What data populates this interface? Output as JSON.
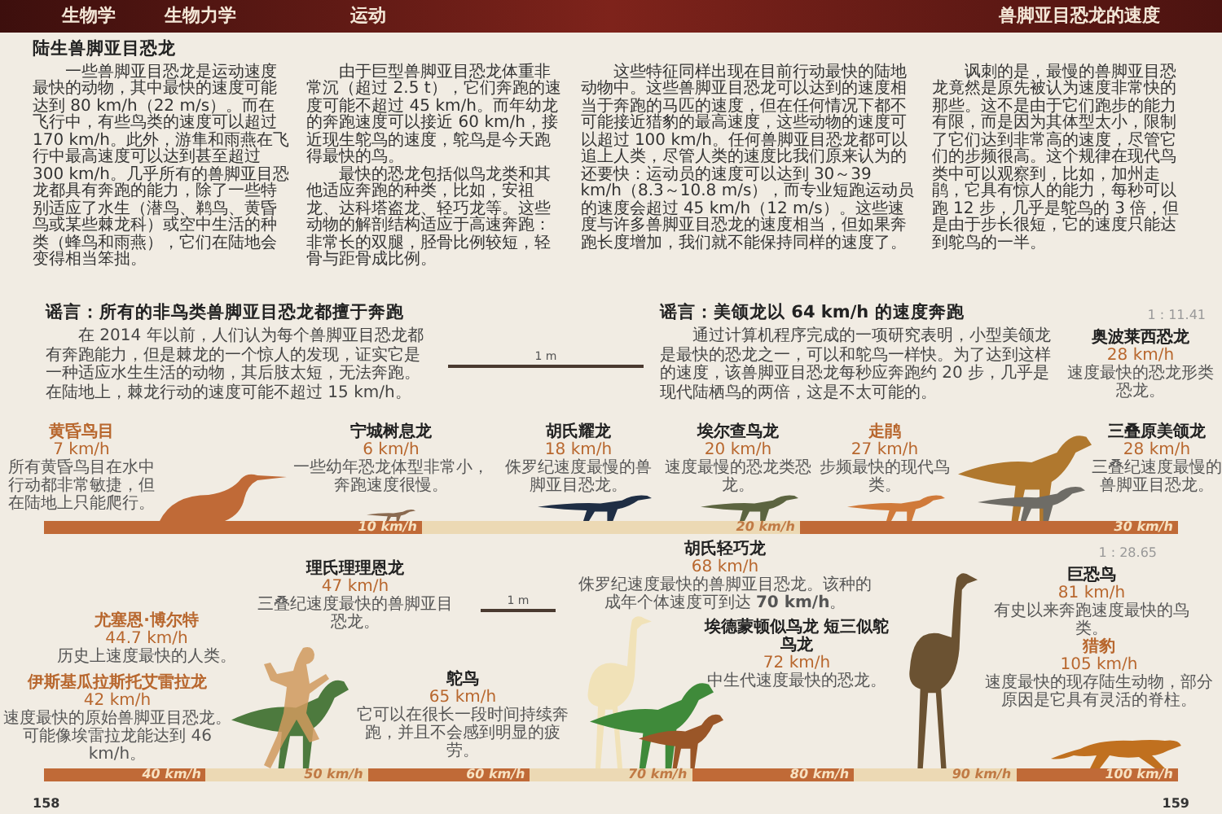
{
  "header": {
    "tabs": [
      {
        "label": "生物学"
      },
      {
        "label": "生物力学"
      },
      {
        "label": "运动"
      }
    ],
    "section_title": "兽脚亚目恐龙的速度"
  },
  "intro": {
    "heading": "陆生兽脚亚目恐龙",
    "columns": [
      [
        "一些兽脚亚目恐龙是运动速度最快的动物，其中最快的速度可能达到 80 km/h（22 m/s）。而在飞行中，有些鸟类的速度可以超过 170 km/h。此外，游隼和雨燕在飞行中最高速度可以达到甚至超过 300 km/h。几乎所有的兽脚亚目恐龙都具有奔跑的能力，除了一些特别适应了水生（潜鸟、鹈鸟、黄昏鸟或某些棘龙科）或空中生活的种类（蜂鸟和雨燕），它们在陆地会变得相当笨拙。"
      ],
      [
        "由于巨型兽脚亚目恐龙体重非常沉（超过 2.5 t），它们奔跑的速度可能不超过 45 km/h。而年幼龙的奔跑速度可以接近 60 km/h，接近现生鸵鸟的速度，鸵鸟是今天跑得最快的鸟。",
        "最快的恐龙包括似鸟龙类和其他适应奔跑的种类，比如，安祖龙、达科塔盗龙、轻巧龙等。这些动物的解剖结构适应于高速奔跑：非常长的双腿，胫骨比例较短，轻骨与距骨成比例。"
      ],
      [
        "这些特征同样出现在目前行动最快的陆地动物中。这些兽脚亚目恐龙可以达到的速度相当于奔跑的马匹的速度，但在任何情况下都不可能接近猎豹的最高速度，这些动物的速度可以超过 100 km/h。任何兽脚亚目恐龙都可以追上人类，尽管人类的速度比我们原来认为的还要快：运动员的速度可以达到 30～39 km/h（8.3～10.8 m/s），而专业短跑运动员的速度会超过 45 km/h（12 m/s）。这些速度与许多兽脚亚目恐龙的速度相当，但如果奔跑长度增加，我们就不能保持同样的速度了。"
      ],
      [
        "讽刺的是，最慢的兽脚亚目恐龙竟然是原先被认为速度非常快的那些。这不是由于它们跑步的能力有限，而是因为其体型太小，限制了它们达到非常高的速度，尽管它们的步频很高。这个规律在现代鸟类中可以观察到，比如，加州走鹃，它具有惊人的能力，每秒可以跑 12 步，几乎是鸵鸟的 3 倍，但是由于步长很短，它的速度只能达到鸵鸟的一半。"
      ]
    ]
  },
  "charts": [
    {
      "myths": [
        {
          "heading": "谣言：所有的非鸟类兽脚亚目恐龙都擅于奔跑",
          "text": "在 2014 年以前，人们认为每个兽脚亚目恐龙都有奔跑能力，但是棘龙的一个惊人的发现，证实它是一种适应水生生活的动物，其后肢太短，无法奔跑。在陆地上，棘龙行动的速度可能不超过 15 km/h。"
        },
        {
          "heading": "谣言：美颌龙以 64 km/h 的速度奔跑",
          "text": "通过计算机程序完成的一项研究表明，小型美颌龙是最快的恐龙之一，可以和鸵鸟一样快。为了达到这样的速度，该兽脚亚目恐龙每秒应奔跑约 20 步，几乎是现代陆栖鸟的两倍，这是不太可能的。"
        }
      ],
      "scale_bar": "1 m",
      "scale_ratio": "1 : 11.41",
      "animals": [
        {
          "kind": "dinosaur",
          "name": "奥波莱西恐龙",
          "speed": "28 km/h",
          "note": "速度最快的恐龙形类恐龙。"
        },
        {
          "kind": "comparison",
          "name": "黄昏鸟目",
          "speed": "7 km/h",
          "note": "所有黄昏鸟目在水中行动都非常敏捷，但在陆地上只能爬行。"
        },
        {
          "kind": "dinosaur",
          "name": "宁城树息龙",
          "speed": "6 km/h",
          "note": "一些幼年恐龙体型非常小，奔跑速度很慢。"
        },
        {
          "kind": "dinosaur",
          "name": "胡氏耀龙",
          "speed": "18 km/h",
          "note": "侏罗纪速度最慢的兽脚亚目恐龙。"
        },
        {
          "kind": "dinosaur",
          "name": "埃尔查鸟龙",
          "speed": "20 km/h",
          "note": "速度最慢的恐龙类恐龙。"
        },
        {
          "kind": "comparison",
          "name": "走鹃",
          "speed": "27 km/h",
          "note": "步频最快的现代鸟类。"
        },
        {
          "kind": "dinosaur",
          "name": "三叠原美颌龙",
          "speed": "28 km/h",
          "note": "三叠纪速度最慢的兽脚亚目恐龙。"
        }
      ],
      "speed_bar": [
        {
          "label": "10 km/h",
          "kind": "dark"
        },
        {
          "label": "20 km/h",
          "kind": "light"
        },
        {
          "label": "30 km/h",
          "kind": "dark"
        }
      ]
    },
    {
      "scale_bar": "1 m",
      "scale_ratio": "1 : 28.65",
      "animals": [
        {
          "kind": "comparison",
          "name": "尤塞恩·博尔特",
          "speed": "44.7 km/h",
          "note": "历史上速度最快的人类。"
        },
        {
          "kind": "comparison",
          "name": "伊斯基瓜拉斯托艾雷拉龙",
          "speed": "42 km/h",
          "note": "速度最快的原始兽脚亚目恐龙。可能像埃雷拉龙能达到 46 km/h。"
        },
        {
          "kind": "dinosaur",
          "name": "理氏理理恩龙",
          "speed": "47 km/h",
          "note": "三叠纪速度最快的兽脚亚目恐龙。"
        },
        {
          "kind": "dinosaur",
          "name": "鸵鸟",
          "speed": "65 km/h",
          "note": "它可以在很长一段时间持续奔跑，并且不会感到明显的疲劳。"
        },
        {
          "kind": "dinosaur",
          "name": "胡氏轻巧龙",
          "speed": "68 km/h",
          "note": "侏罗纪速度最快的兽脚亚目恐龙。该种的成年个体速度可到达 **70 km/h**。"
        },
        {
          "kind": "dinosaur",
          "name": "埃德蒙顿似鸟龙 短三似鸵鸟龙",
          "speed": "72 km/h",
          "note": "中生代速度最快的恐龙。"
        },
        {
          "kind": "dinosaur",
          "name": "巨恐鸟",
          "speed": "81 km/h",
          "note": "有史以来奔跑速度最快的鸟类。"
        },
        {
          "kind": "comparison",
          "name": "猎豹",
          "speed": "105 km/h",
          "note": "速度最快的现存陆生动物，部分原因是它具有灵活的脊柱。"
        }
      ],
      "speed_bar": [
        {
          "label": "40 km/h",
          "kind": "dark"
        },
        {
          "label": "50 km/h",
          "kind": "light"
        },
        {
          "label": "60 km/h",
          "kind": "dark"
        },
        {
          "label": "70 km/h",
          "kind": "light"
        },
        {
          "label": "80 km/h",
          "kind": "dark"
        },
        {
          "label": "90 km/h",
          "kind": "light"
        },
        {
          "label": "100 km/h",
          "kind": "dark"
        }
      ]
    }
  ],
  "page_numbers": [
    "158",
    "159"
  ]
}
